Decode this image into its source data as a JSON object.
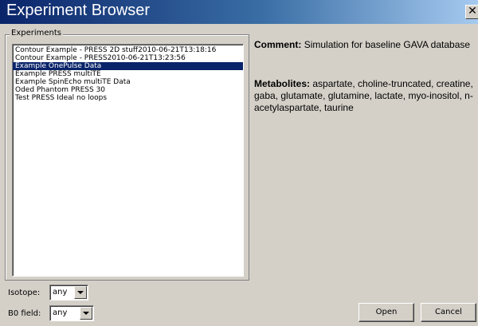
{
  "window": {
    "title": "Experiment Browser",
    "close_glyph": "✕"
  },
  "experiments": {
    "group_label": "Experiments",
    "items": [
      "Contour Example - PRESS 2D stuff2010-06-21T13:18:16",
      "Contour Example - PRESS2010-06-21T13:23:56",
      "Example OnePulse Data",
      "Example PRESS multiTE",
      "Example SpinEcho multiTE Data",
      "Oded Phantom PRESS 30",
      "Test PRESS Ideal no loops"
    ],
    "selected": "Example OnePulse Data"
  },
  "filters": {
    "isotope_label": "Isotope:",
    "isotope_value": "any",
    "b0_label": "B0 field:",
    "b0_value": "any"
  },
  "details": {
    "comment_label": "Comment:",
    "comment_text": "Simulation for baseline GAVA database",
    "metabolites_label": "Metabolites:",
    "metabolites_text": "aspartate, choline-truncated, creatine, gaba, glutamate, glutamine, lactate, myo-inositol, n-acetylaspartate, taurine"
  },
  "buttons": {
    "open": "Open",
    "cancel": "Cancel"
  },
  "colors": {
    "selection": "#0a246a",
    "titlebar": "#0a246a",
    "face": "#d4d0c8"
  }
}
